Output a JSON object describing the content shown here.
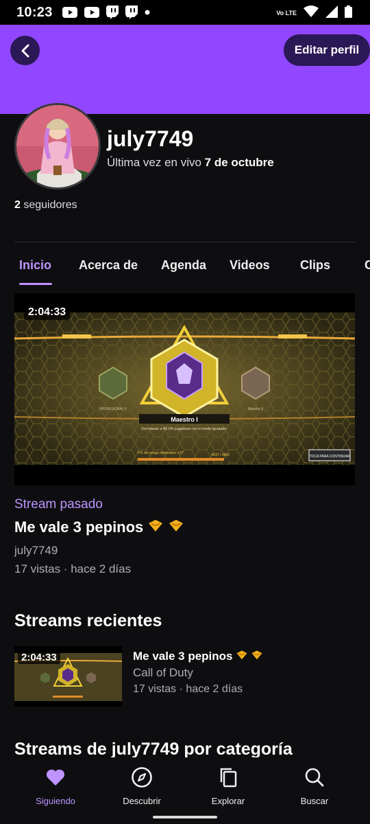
{
  "status_bar": {
    "time": "10:23",
    "network": "Vo LTE"
  },
  "header": {
    "edit_label": "Editar perfil"
  },
  "profile": {
    "username": "july7749",
    "last_live_prefix": "Última vez en vivo",
    "last_live_date": "7 de octubre",
    "followers_count": "2",
    "followers_label": "seguidores"
  },
  "tabs": [
    {
      "label": "Inicio",
      "active": true
    },
    {
      "label": "Acerca de"
    },
    {
      "label": "Agenda"
    },
    {
      "label": "Videos"
    },
    {
      "label": "Clips"
    },
    {
      "label": "C"
    }
  ],
  "featured": {
    "duration": "2:04:33",
    "thumb_rank_title": "Maestro I",
    "thumb_rank_sub": "Derrotaste a 80.0% jugadores en el modo igualado.",
    "thumb_left_rank": "PROFESIONAL V",
    "thumb_right_rank": "Maestro II",
    "thumb_xp_label": "PX de rango obtenidos +27",
    "thumb_xp_value": "4537 / 4800",
    "thumb_continue": "TOCA PARA CONTINUAR",
    "label": "Stream pasado",
    "title": "Me vale 3 pepinos",
    "channel": "july7749",
    "meta": "17 vistas · hace 2 días"
  },
  "recent": {
    "section_title": "Streams recientes",
    "items": [
      {
        "duration": "2:04:33",
        "title": "Me vale 3 pepinos",
        "game": "Call of Duty",
        "meta": "17 vistas · hace 2 días"
      }
    ]
  },
  "category": {
    "section_title": "Streams de july7749 por categoría"
  },
  "bottom_nav": [
    {
      "label": "Siguiendo",
      "icon": "heart-icon",
      "active": true
    },
    {
      "label": "Descubrir",
      "icon": "compass-icon"
    },
    {
      "label": "Explorar",
      "icon": "browse-icon"
    },
    {
      "label": "Buscar",
      "icon": "search-icon"
    }
  ],
  "colors": {
    "accent": "#9147ff",
    "accent_light": "#bf94ff",
    "background": "#0e0e10",
    "header_button": "#2b1856"
  }
}
